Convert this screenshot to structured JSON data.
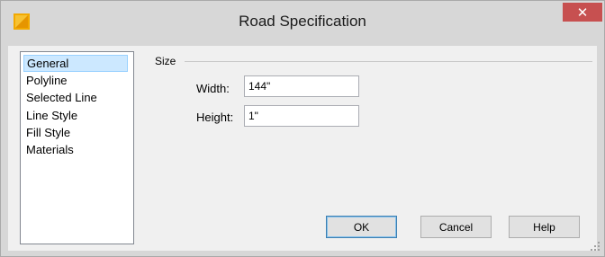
{
  "window": {
    "title": "Road Specification",
    "close_glyph": "✕",
    "icon": "app-icon"
  },
  "nav": {
    "items": [
      {
        "label": "General",
        "selected": true
      },
      {
        "label": "Polyline",
        "selected": false
      },
      {
        "label": "Selected Line",
        "selected": false
      },
      {
        "label": "Line Style",
        "selected": false
      },
      {
        "label": "Fill Style",
        "selected": false
      },
      {
        "label": "Materials",
        "selected": false
      }
    ]
  },
  "size_group": {
    "label": "Size",
    "width_label": "Width:",
    "width_value": "144\"",
    "height_label": "Height:",
    "height_value": "1\""
  },
  "buttons": {
    "ok": "OK",
    "cancel": "Cancel",
    "help": "Help"
  },
  "colors": {
    "close_button": "#c75050",
    "selection": "#cce8ff",
    "app_icon": "#f2a900"
  }
}
